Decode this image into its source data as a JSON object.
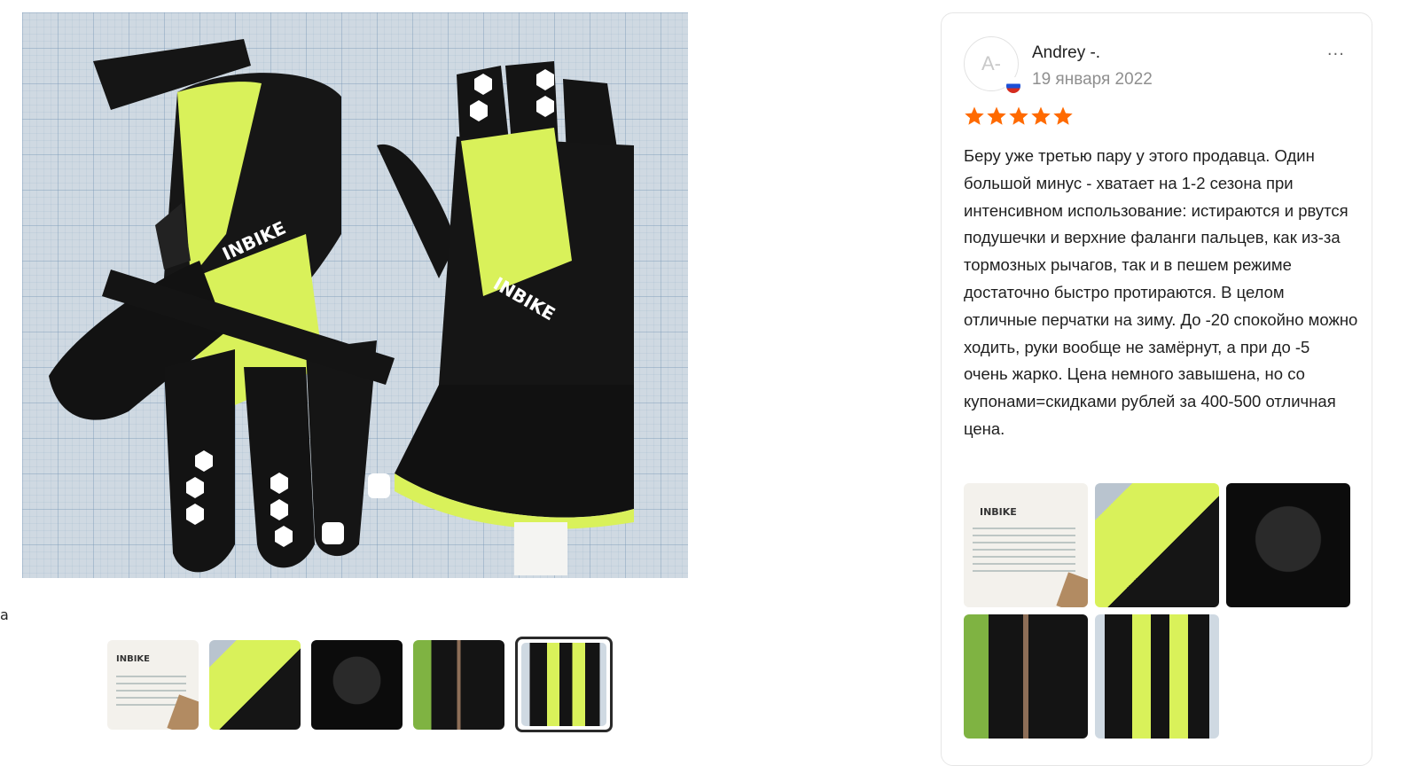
{
  "viewer": {
    "stray_text": "a",
    "main_image_alt": "INBIKE",
    "thumbnails": [
      {
        "name": "label-photo",
        "brand": "INBIKE"
      },
      {
        "name": "glove-closeup-photo"
      },
      {
        "name": "palm-photo"
      },
      {
        "name": "pair-on-table-photo"
      },
      {
        "name": "pair-on-grid-photo",
        "selected": true
      }
    ]
  },
  "review": {
    "avatar_initials": "A-",
    "author": "Andrey -.",
    "date": "19 января 2022",
    "rating": 5,
    "rating_max": 5,
    "more_label": "···",
    "text": "Беру уже третью пару у этого продавца. Один большой минус - хватает на 1-2 сезона при интенсивном использование: истираются и рвутся подушечки и верхние фаланги пальцев, как из-за тормозных рычагов, так и в пешем режиме достаточно быстро протираются. В целом отличные перчатки на зиму. До -20 спокойно можно ходить, руки вообще не замёрнут, а при до -5 очень жарко. Цена немного завышена, но со купонами=скидками рублей за 400-500 отличная цена.",
    "photos": [
      {
        "name": "label-photo",
        "brand": "INBIKE"
      },
      {
        "name": "glove-closeup-photo"
      },
      {
        "name": "palm-photo"
      },
      {
        "name": "pair-on-table-photo"
      },
      {
        "name": "pair-on-grid-photo"
      }
    ]
  },
  "colors": {
    "star": "#ff6a00",
    "glove_green": "#d9f15a",
    "glove_black": "#111111"
  }
}
